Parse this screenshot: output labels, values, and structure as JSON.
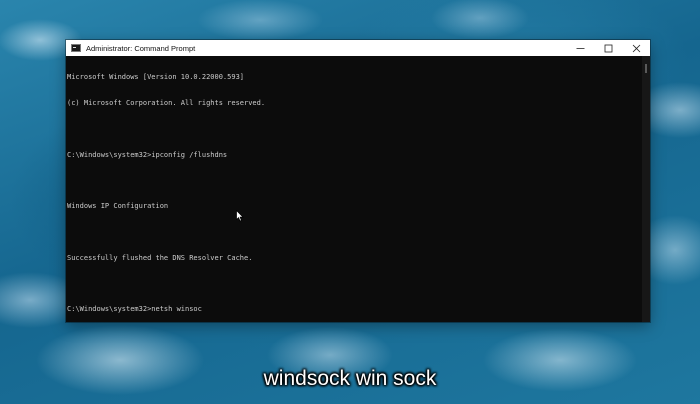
{
  "window": {
    "title": "Administrator: Command Prompt",
    "controls": {
      "minimize_icon": "minimize-icon",
      "maximize_icon": "maximize-icon",
      "close_icon": "close-icon"
    }
  },
  "console": {
    "lines": [
      "Microsoft Windows [Version 10.0.22000.593]",
      "(c) Microsoft Corporation. All rights reserved.",
      "",
      "C:\\Windows\\system32>ipconfig /flushdns",
      "",
      "Windows IP Configuration",
      "",
      "Successfully flushed the DNS Resolver Cache.",
      "",
      "C:\\Windows\\system32>netsh winsoc"
    ],
    "text_color": "#cccccc",
    "background_color": "#0c0c0c"
  },
  "subtitle": {
    "text": "windsock win sock"
  },
  "colors": {
    "titlebar": "#ffffff",
    "desktop": "#1c6c94"
  }
}
